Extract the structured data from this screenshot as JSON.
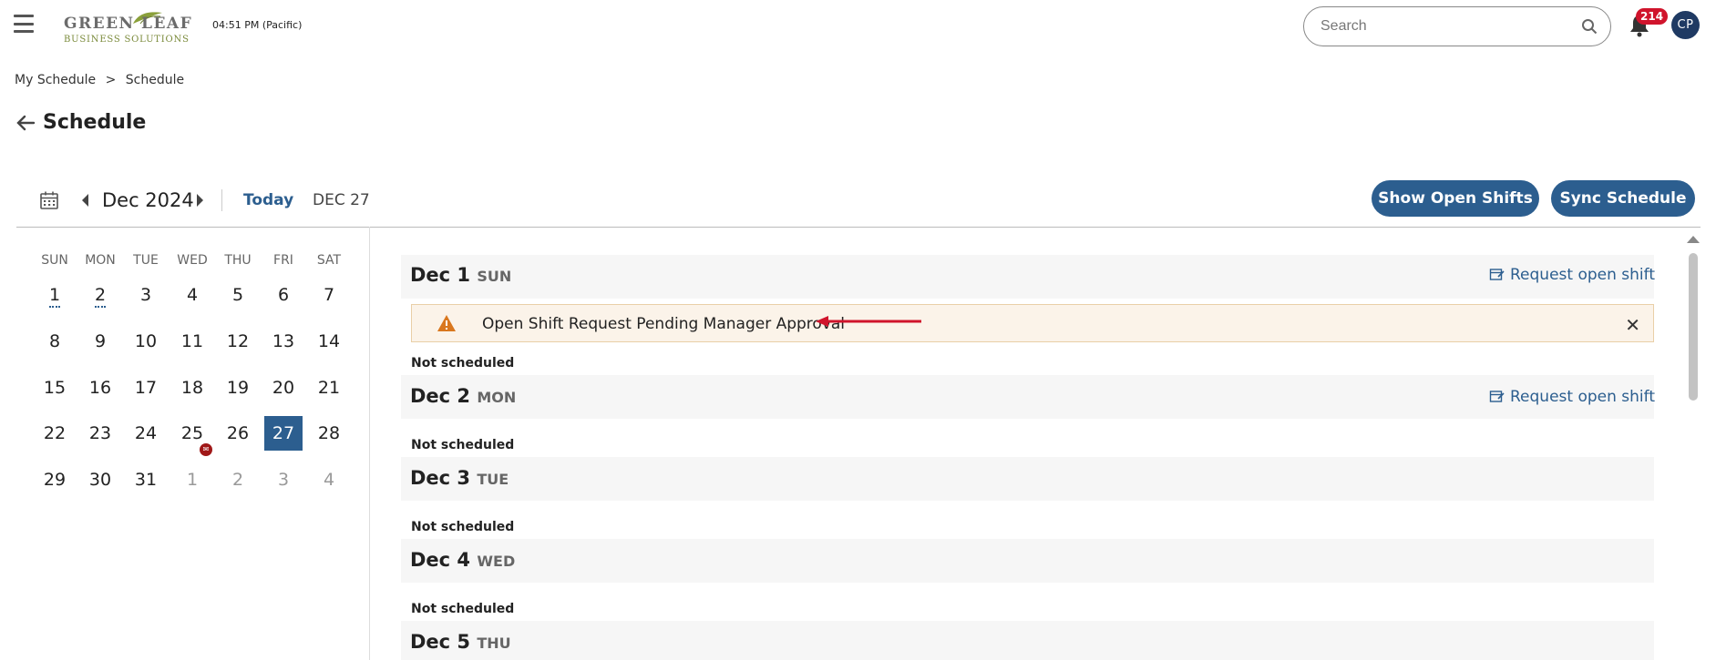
{
  "header": {
    "logo_line1": "GREEN LEAF",
    "logo_line2": "BUSINESS SOLUTIONS",
    "time": "04:51 PM (Pacific)",
    "search_placeholder": "Search",
    "notification_count": "214",
    "avatar_initials": "CP"
  },
  "breadcrumb": {
    "parent": "My Schedule",
    "separator": ">",
    "current": "Schedule"
  },
  "page_title": "Schedule",
  "toolbar": {
    "month": "Dec 2024",
    "today_label": "Today",
    "current_date": "DEC 27",
    "show_open_shifts": "Show Open Shifts",
    "sync_schedule": "Sync Schedule"
  },
  "calendar": {
    "weekdays": [
      "SUN",
      "MON",
      "TUE",
      "WED",
      "THU",
      "FRI",
      "SAT"
    ],
    "weeks": [
      [
        "1",
        "2",
        "3",
        "4",
        "5",
        "6",
        "7"
      ],
      [
        "8",
        "9",
        "10",
        "11",
        "12",
        "13",
        "14"
      ],
      [
        "15",
        "16",
        "17",
        "18",
        "19",
        "20",
        "21"
      ],
      [
        "22",
        "23",
        "24",
        "25",
        "26",
        "27",
        "28"
      ],
      [
        "29",
        "30",
        "31",
        "1",
        "2",
        "3",
        "4"
      ]
    ],
    "selected": "27",
    "holiday_day": "25"
  },
  "schedule": {
    "request_label": "Request open shift",
    "not_scheduled": "Not scheduled",
    "alert_text": "Open Shift Request Pending Manager Approval",
    "days": [
      {
        "date": "Dec 1",
        "dow": "SUN"
      },
      {
        "date": "Dec 2",
        "dow": "MON"
      },
      {
        "date": "Dec 3",
        "dow": "TUE"
      },
      {
        "date": "Dec 4",
        "dow": "WED"
      },
      {
        "date": "Dec 5",
        "dow": "THU"
      }
    ]
  },
  "colors": {
    "primary": "#2c5e8f",
    "badge": "#d0142c",
    "avatar": "#1f3a63",
    "alert_bg": "#fbf3e9",
    "warning": "#d9771e",
    "arrow": "#d0142c"
  }
}
